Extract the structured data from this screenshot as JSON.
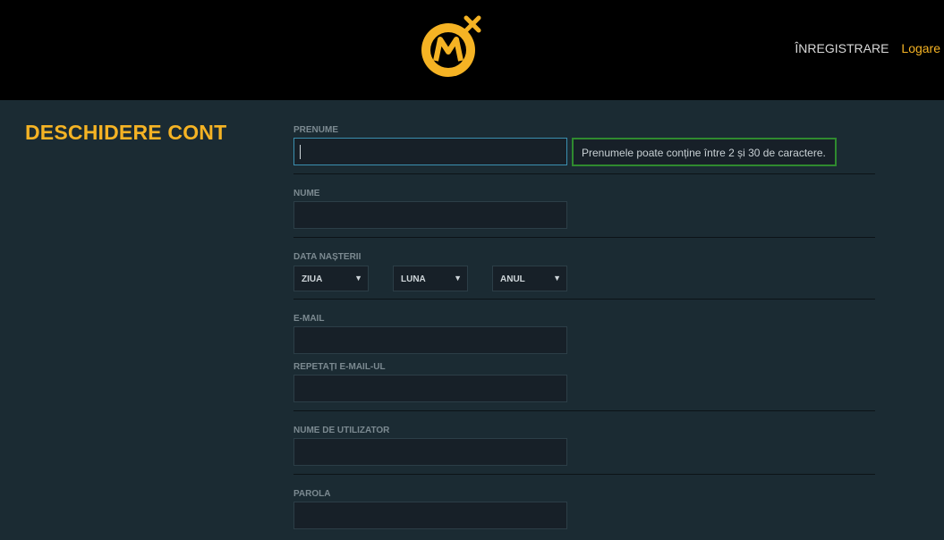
{
  "header": {
    "logo_alt": "M",
    "nav": {
      "register": "ÎNREGISTRARE",
      "login": "Logare"
    }
  },
  "page": {
    "title": "DESCHIDERE CONT"
  },
  "form": {
    "first_name": {
      "label": "PRENUME",
      "value": "",
      "tooltip": "Prenumele poate conține între 2 și 30 de caractere."
    },
    "last_name": {
      "label": "NUME",
      "value": ""
    },
    "birth_date": {
      "label": "DATA NAȘTERII",
      "day": "ZIUA",
      "month": "LUNA",
      "year": "ANUL"
    },
    "email": {
      "label": "E-MAIL",
      "value": ""
    },
    "email_repeat": {
      "label": "REPETAȚI E-MAIL-UL",
      "value": ""
    },
    "username": {
      "label": "NUME DE UTILIZATOR",
      "value": ""
    },
    "password": {
      "label": "PAROLA",
      "value": ""
    }
  },
  "colors": {
    "accent": "#f5b324",
    "bg": "#1b2b33",
    "success": "#2f8a2f"
  }
}
